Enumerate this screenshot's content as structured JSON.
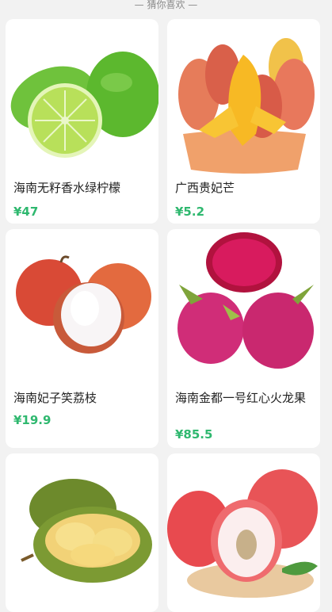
{
  "header": {
    "title": "— 猜你喜欢 —"
  },
  "products": [
    {
      "name": "海南无籽香水绿柠檬",
      "price": "¥47"
    },
    {
      "name": "广西贵妃芒",
      "price": "¥5.2"
    },
    {
      "name": "海南妃子笑荔枝",
      "price": "¥19.9"
    },
    {
      "name": "海南金都一号红心火龙果",
      "price": "¥85.5"
    },
    {
      "name": "",
      "price": ""
    },
    {
      "name": "",
      "price": ""
    }
  ],
  "colors": {
    "price": "#2fb86f",
    "background": "#f2f2f2"
  }
}
